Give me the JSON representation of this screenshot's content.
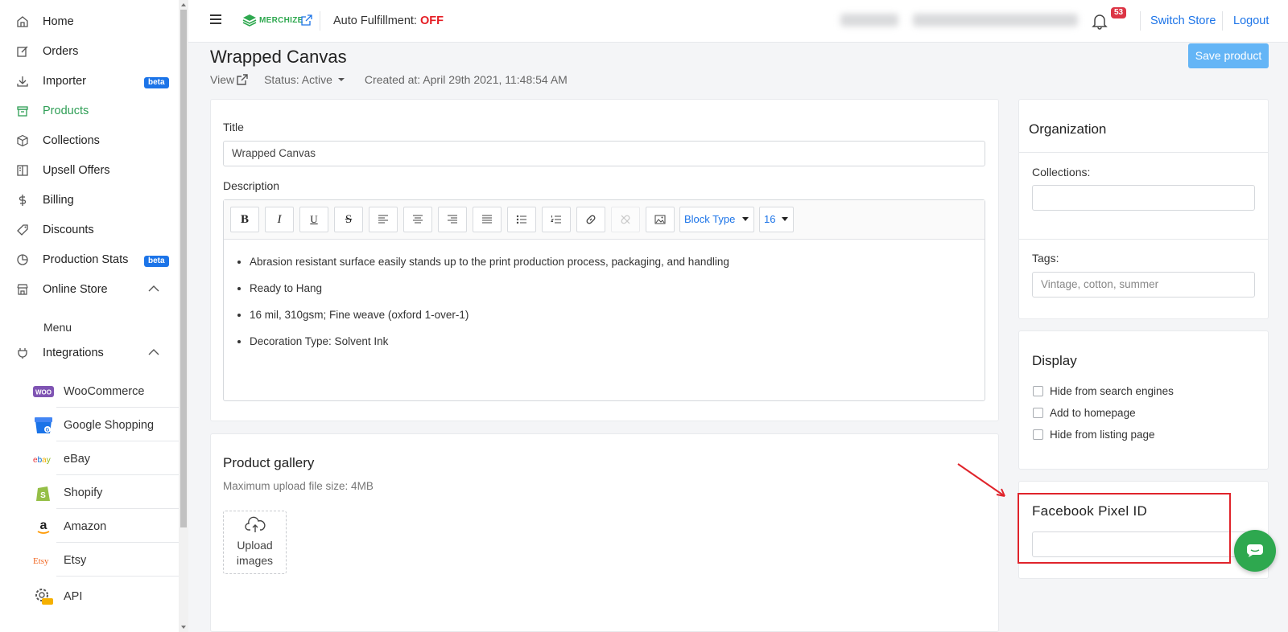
{
  "sidebar": {
    "items": [
      {
        "label": "Home",
        "icon": "home-icon"
      },
      {
        "label": "Orders",
        "icon": "edit-icon"
      },
      {
        "label": "Importer",
        "icon": "download-icon",
        "badge": "beta"
      },
      {
        "label": "Products",
        "icon": "archive-icon",
        "active": true
      },
      {
        "label": "Collections",
        "icon": "cube-icon"
      },
      {
        "label": "Upsell Offers",
        "icon": "book-icon"
      },
      {
        "label": "Billing",
        "icon": "dollar-icon"
      },
      {
        "label": "Discounts",
        "icon": "tag-icon"
      },
      {
        "label": "Production Stats",
        "icon": "pie-chart-icon",
        "badge": "beta"
      },
      {
        "label": "Online Store",
        "icon": "store-icon"
      },
      {
        "label": "Integrations",
        "icon": "plug-icon"
      }
    ],
    "online_store_sub": "Menu",
    "integrations": [
      {
        "label": "WooCommerce"
      },
      {
        "label": "Google Shopping"
      },
      {
        "label": "eBay"
      },
      {
        "label": "Shopify"
      },
      {
        "label": "Amazon"
      },
      {
        "label": "Etsy"
      },
      {
        "label": "API"
      }
    ],
    "accent_color": "#2e9e55"
  },
  "header": {
    "brand": "MERCHIZE",
    "auto_fulfillment_label": "Auto Fulfillment:",
    "auto_fulfillment_value": "OFF",
    "notification_count": "53",
    "switch_store": "Switch Store",
    "logout": "Logout"
  },
  "product": {
    "title": "Wrapped Canvas",
    "view_label": "View",
    "status": "Status: Active",
    "created_at": "Created at: April 29th 2021, 11:48:54 AM",
    "save_button": "Save product"
  },
  "form": {
    "title_label": "Title",
    "title_value": "Wrapped Canvas",
    "description_label": "Description",
    "toolbar": {
      "bold": "B",
      "italic": "I",
      "underline": "U",
      "strike": "S",
      "block_type": "Block Type",
      "font_size": "16"
    },
    "description_items": [
      "Abrasion resistant surface easily stands up to the print production process, packaging, and handling",
      "Ready to Hang",
      "16 mil, 310gsm; Fine weave (oxford 1-over-1)",
      "Decoration Type: Solvent Ink"
    ]
  },
  "gallery": {
    "title": "Product gallery",
    "max_size": "Maximum upload file size: 4MB",
    "upload_label_1": "Upload",
    "upload_label_2": "images"
  },
  "organization": {
    "title": "Organization",
    "collections_label": "Collections:",
    "collections_value": "",
    "tags_label": "Tags:",
    "tags_placeholder": "Vintage, cotton, summer"
  },
  "display": {
    "title": "Display",
    "options": [
      {
        "label": "Hide from search engines",
        "checked": false
      },
      {
        "label": "Add to homepage",
        "checked": false
      },
      {
        "label": "Hide from listing page",
        "checked": false
      }
    ]
  },
  "facebook": {
    "title": "Facebook Pixel ID",
    "value": ""
  }
}
